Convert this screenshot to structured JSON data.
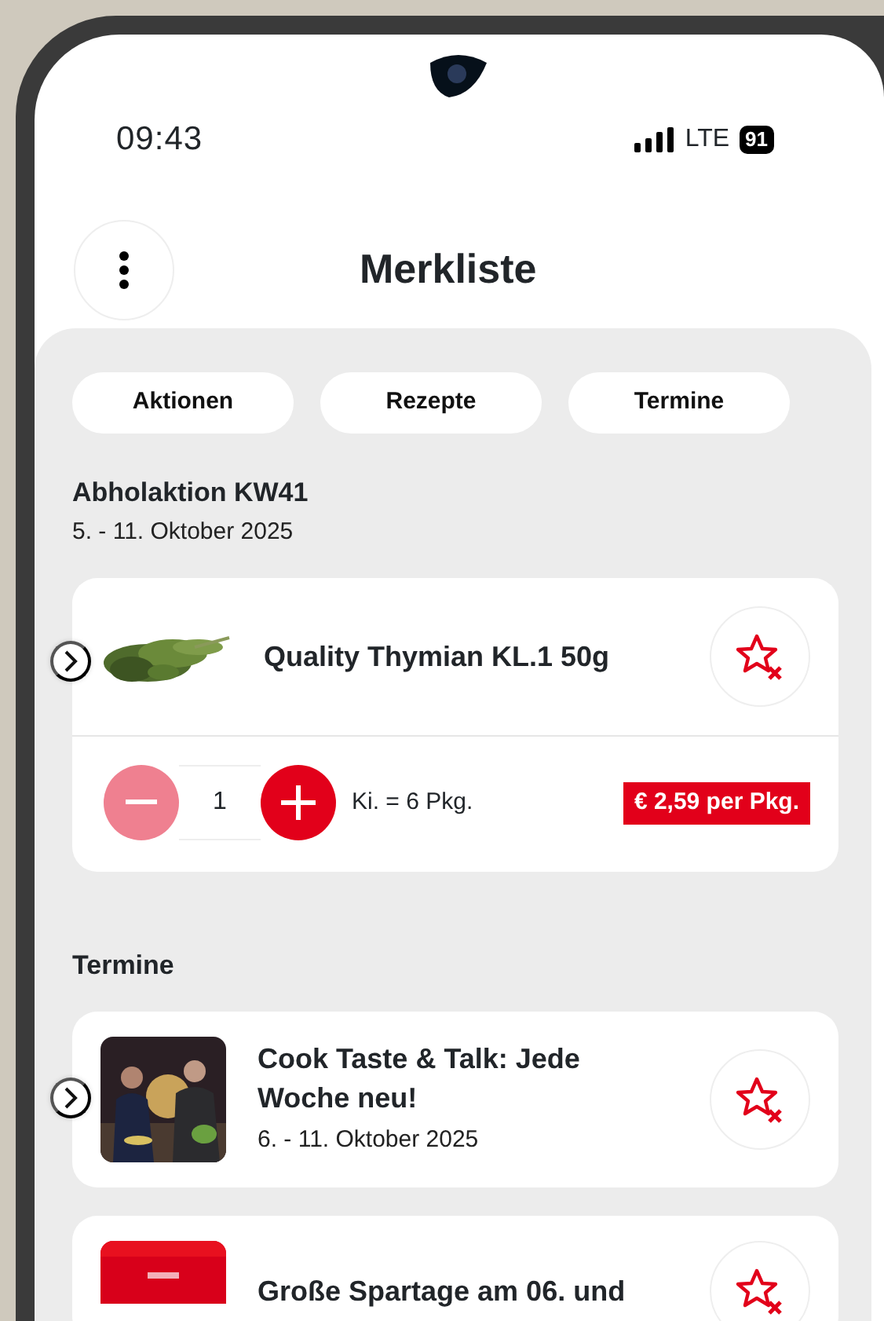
{
  "status_bar": {
    "time": "09:43",
    "network": "LTE",
    "battery": "91"
  },
  "header": {
    "title": "Merkliste"
  },
  "chips": [
    {
      "label": "Aktionen"
    },
    {
      "label": "Rezepte"
    },
    {
      "label": "Termine"
    }
  ],
  "sections": [
    {
      "title": "Abholaktion KW41",
      "subtitle": "5. - 11. Oktober 2025",
      "items": [
        {
          "kind": "product",
          "name": "Quality Thymian KL.1 50g",
          "quantity": "1",
          "decrement_disabled": true,
          "pack": "Ki. = 6 Pkg.",
          "price": "€ 2,59 per Pkg."
        }
      ]
    },
    {
      "title": "Termine",
      "items": [
        {
          "kind": "event",
          "name": "Cook Taste & Talk: Jede Woche neu!",
          "date": "6. - 11. Oktober 2025"
        },
        {
          "kind": "event",
          "name": "Große Spartage am 06. und"
        }
      ]
    }
  ]
}
